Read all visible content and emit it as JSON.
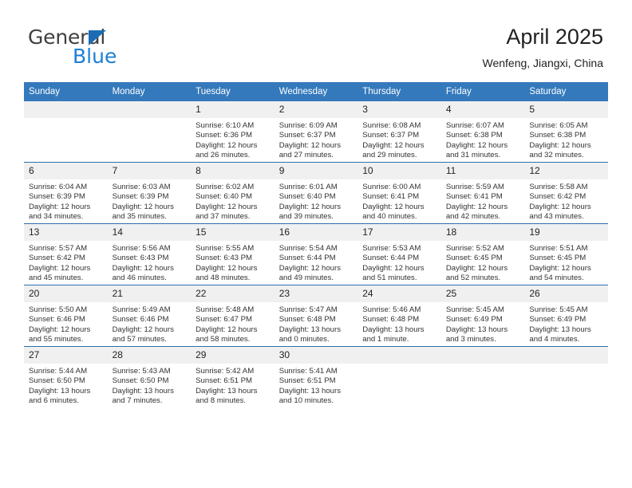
{
  "logo": {
    "word_top": "General",
    "word_bottom": "Blue",
    "triangle_icon": "triangle-icon",
    "color_dark": "#404040",
    "color_blue": "#1d7fd4"
  },
  "header": {
    "title": "April 2025",
    "subtitle": "Wenfeng, Jiangxi, China"
  },
  "theme": {
    "header_blue": "#3479bb",
    "row_divider_blue": "#2f6fad",
    "daynum_band": "#f0f0f0"
  },
  "weekday_headers": [
    "Sunday",
    "Monday",
    "Tuesday",
    "Wednesday",
    "Thursday",
    "Friday",
    "Saturday"
  ],
  "weeks": [
    [
      {
        "day": "",
        "sunrise": "",
        "sunset": "",
        "daylight": "",
        "empty": true
      },
      {
        "day": "",
        "sunrise": "",
        "sunset": "",
        "daylight": "",
        "empty": true
      },
      {
        "day": "1",
        "sunrise": "Sunrise: 6:10 AM",
        "sunset": "Sunset: 6:36 PM",
        "daylight": "Daylight: 12 hours and 26 minutes."
      },
      {
        "day": "2",
        "sunrise": "Sunrise: 6:09 AM",
        "sunset": "Sunset: 6:37 PM",
        "daylight": "Daylight: 12 hours and 27 minutes."
      },
      {
        "day": "3",
        "sunrise": "Sunrise: 6:08 AM",
        "sunset": "Sunset: 6:37 PM",
        "daylight": "Daylight: 12 hours and 29 minutes."
      },
      {
        "day": "4",
        "sunrise": "Sunrise: 6:07 AM",
        "sunset": "Sunset: 6:38 PM",
        "daylight": "Daylight: 12 hours and 31 minutes."
      },
      {
        "day": "5",
        "sunrise": "Sunrise: 6:05 AM",
        "sunset": "Sunset: 6:38 PM",
        "daylight": "Daylight: 12 hours and 32 minutes."
      }
    ],
    [
      {
        "day": "6",
        "sunrise": "Sunrise: 6:04 AM",
        "sunset": "Sunset: 6:39 PM",
        "daylight": "Daylight: 12 hours and 34 minutes."
      },
      {
        "day": "7",
        "sunrise": "Sunrise: 6:03 AM",
        "sunset": "Sunset: 6:39 PM",
        "daylight": "Daylight: 12 hours and 35 minutes."
      },
      {
        "day": "8",
        "sunrise": "Sunrise: 6:02 AM",
        "sunset": "Sunset: 6:40 PM",
        "daylight": "Daylight: 12 hours and 37 minutes."
      },
      {
        "day": "9",
        "sunrise": "Sunrise: 6:01 AM",
        "sunset": "Sunset: 6:40 PM",
        "daylight": "Daylight: 12 hours and 39 minutes."
      },
      {
        "day": "10",
        "sunrise": "Sunrise: 6:00 AM",
        "sunset": "Sunset: 6:41 PM",
        "daylight": "Daylight: 12 hours and 40 minutes."
      },
      {
        "day": "11",
        "sunrise": "Sunrise: 5:59 AM",
        "sunset": "Sunset: 6:41 PM",
        "daylight": "Daylight: 12 hours and 42 minutes."
      },
      {
        "day": "12",
        "sunrise": "Sunrise: 5:58 AM",
        "sunset": "Sunset: 6:42 PM",
        "daylight": "Daylight: 12 hours and 43 minutes."
      }
    ],
    [
      {
        "day": "13",
        "sunrise": "Sunrise: 5:57 AM",
        "sunset": "Sunset: 6:42 PM",
        "daylight": "Daylight: 12 hours and 45 minutes."
      },
      {
        "day": "14",
        "sunrise": "Sunrise: 5:56 AM",
        "sunset": "Sunset: 6:43 PM",
        "daylight": "Daylight: 12 hours and 46 minutes."
      },
      {
        "day": "15",
        "sunrise": "Sunrise: 5:55 AM",
        "sunset": "Sunset: 6:43 PM",
        "daylight": "Daylight: 12 hours and 48 minutes."
      },
      {
        "day": "16",
        "sunrise": "Sunrise: 5:54 AM",
        "sunset": "Sunset: 6:44 PM",
        "daylight": "Daylight: 12 hours and 49 minutes."
      },
      {
        "day": "17",
        "sunrise": "Sunrise: 5:53 AM",
        "sunset": "Sunset: 6:44 PM",
        "daylight": "Daylight: 12 hours and 51 minutes."
      },
      {
        "day": "18",
        "sunrise": "Sunrise: 5:52 AM",
        "sunset": "Sunset: 6:45 PM",
        "daylight": "Daylight: 12 hours and 52 minutes."
      },
      {
        "day": "19",
        "sunrise": "Sunrise: 5:51 AM",
        "sunset": "Sunset: 6:45 PM",
        "daylight": "Daylight: 12 hours and 54 minutes."
      }
    ],
    [
      {
        "day": "20",
        "sunrise": "Sunrise: 5:50 AM",
        "sunset": "Sunset: 6:46 PM",
        "daylight": "Daylight: 12 hours and 55 minutes."
      },
      {
        "day": "21",
        "sunrise": "Sunrise: 5:49 AM",
        "sunset": "Sunset: 6:46 PM",
        "daylight": "Daylight: 12 hours and 57 minutes."
      },
      {
        "day": "22",
        "sunrise": "Sunrise: 5:48 AM",
        "sunset": "Sunset: 6:47 PM",
        "daylight": "Daylight: 12 hours and 58 minutes."
      },
      {
        "day": "23",
        "sunrise": "Sunrise: 5:47 AM",
        "sunset": "Sunset: 6:48 PM",
        "daylight": "Daylight: 13 hours and 0 minutes."
      },
      {
        "day": "24",
        "sunrise": "Sunrise: 5:46 AM",
        "sunset": "Sunset: 6:48 PM",
        "daylight": "Daylight: 13 hours and 1 minute."
      },
      {
        "day": "25",
        "sunrise": "Sunrise: 5:45 AM",
        "sunset": "Sunset: 6:49 PM",
        "daylight": "Daylight: 13 hours and 3 minutes."
      },
      {
        "day": "26",
        "sunrise": "Sunrise: 5:45 AM",
        "sunset": "Sunset: 6:49 PM",
        "daylight": "Daylight: 13 hours and 4 minutes."
      }
    ],
    [
      {
        "day": "27",
        "sunrise": "Sunrise: 5:44 AM",
        "sunset": "Sunset: 6:50 PM",
        "daylight": "Daylight: 13 hours and 6 minutes."
      },
      {
        "day": "28",
        "sunrise": "Sunrise: 5:43 AM",
        "sunset": "Sunset: 6:50 PM",
        "daylight": "Daylight: 13 hours and 7 minutes."
      },
      {
        "day": "29",
        "sunrise": "Sunrise: 5:42 AM",
        "sunset": "Sunset: 6:51 PM",
        "daylight": "Daylight: 13 hours and 8 minutes."
      },
      {
        "day": "30",
        "sunrise": "Sunrise: 5:41 AM",
        "sunset": "Sunset: 6:51 PM",
        "daylight": "Daylight: 13 hours and 10 minutes."
      },
      {
        "day": "",
        "sunrise": "",
        "sunset": "",
        "daylight": "",
        "empty": true
      },
      {
        "day": "",
        "sunrise": "",
        "sunset": "",
        "daylight": "",
        "empty": true
      },
      {
        "day": "",
        "sunrise": "",
        "sunset": "",
        "daylight": "",
        "empty": true
      }
    ]
  ]
}
